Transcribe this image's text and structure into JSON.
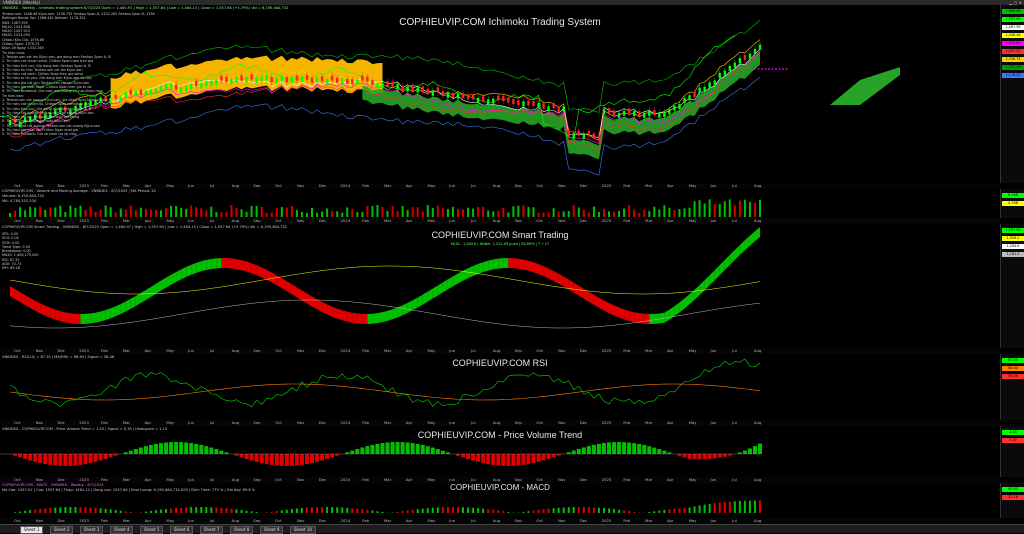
{
  "window": {
    "title": "VNINDEX (Weekly)"
  },
  "panes": {
    "ichimoku": {
      "title": "COPHIEUVIP.COM Ichimoku Trading System",
      "header": "VNINDEX - Weekly - Ichimoku trading system 8/7/2025 Open = 1,460.97 | High = 1,557.64 | Low = 1,464.15 | Close = 1,557.64 (+5.79%) Vol = 6,190,484,732",
      "legend": [
        "Tenkan-sen: 1448.48   Kijun-sen: 1336.735   Senkou Span A: 1332.262   Senkou Span B: 1336",
        "Bollinger Bands Top: 1566.461   Bottom: 1178.331",
        "MA5: 1487.955",
        "MA10: 1423.608",
        "MA20: 1407.523",
        "MA50: 1323.094",
        "Chikou Khu Gia: 1576.86",
        "Chikou Span: 1376.23",
        "Kijun 26 Ngay: 1332.263",
        "Tin hieu mua:",
        "1. Tenkan-sen cat len Kijun-sen, gia dong tren Senkou Span A, B",
        "2. Tin hieu cat chuan xanh, Chikou Span nam tren gia",
        "3. Tin hieu tich cuc: Gia dong tren Senkou Span A, B",
        "4. Tin hieu tin tim: Tenkan-sen cat len Kijun-sen",
        "5. Tin hieu cat xanh: Chikou Span tren gia dong",
        "6. Tin hieu tu tin yeu: Gia dong tren Kijun-sen va day",
        "7. Tin hieu gia cat len: Tenkan-sen cat len Kijun-sen",
        "8. Tin hieu gia vuot xanh: Chikou Span tren gia tu do",
        "9. Tin hieu Breakout: Gia vuot qua khang cu cua nhieu may",
        "Tin hieu ban:",
        "1. Tenkan-sen cat xuong Kijun-sen, gia dong duoi Senkou Span A, B",
        "2. Tin hieu cat chuan do, Chikou Span nam duoi gia",
        "3. Tin hieu tieu cuc: Gia dong duoi Senkou Span A, B",
        "4. Tin hieu cat xuong: Tenkan-sen cat xuong Kijun-sen",
        "5. Tin hieu cat do: Chikou Span duoi gia dong",
        "6. Tin hieu yeu: Gia dong duoi Kijun-sen",
        "7. Tin hieu gia cat xuong: Tenkan-sen cat xuong Kijun-sen",
        "8. Tin hieu gia vuot do: Chikou Span duoi gia",
        "9. Tin hieu Pullback: Gia ve kiem tra lai may"
      ],
      "price_tags": [
        {
          "label": "1,566.46",
          "color": "#00c000"
        },
        {
          "label": "1,557.64",
          "color": "#00ff00"
        },
        {
          "label": "1,487.95",
          "color": "#ffffff"
        },
        {
          "label": "1,448.48",
          "color": "#ffff00"
        },
        {
          "label": "1,423.61",
          "color": "#ff00ff"
        },
        {
          "label": "1,407.52",
          "color": "#ff3030"
        },
        {
          "label": "1,336.74",
          "color": "#ffd000"
        },
        {
          "label": "1,332.26",
          "color": "#00a000"
        },
        {
          "label": "1,178.33",
          "color": "#3a78ff"
        }
      ]
    },
    "volume": {
      "header": "COPHIEUVIP.COM - Volume and Moving Average - VNINDEX - 8/7/2025 | MA Period: 20",
      "line2": "Volume: 6,190,484,732",
      "line3": "MA: 4,784,352,334",
      "tags": [
        {
          "label": "6.19B",
          "color": "#00ff00"
        },
        {
          "label": "4.78B",
          "color": "#ffff00"
        }
      ]
    },
    "smart": {
      "title": "COPHIEUVIP.COM Smart Trading",
      "header": "COPHIEUVIP.COM Smart Trading - VNINDEX - 8/7/2025 Open = 1,460.97 | High = 1,557.64 | Low = 1,464.15 | Close = 1,557.64 (+5.79%) Vol = 6,190,484,732",
      "subtitle": "MUA - 1,284.8 | Nhắm: 1,212.83 point | 26.89% | T + 17",
      "legend": [
        "SPS: 0.00",
        "SCH: 0.00",
        "SCM: 0.00",
        "Trend Type: 0.00",
        "Breakdown: 0.00",
        "MA50: 1,406,175,000",
        "RSI: 87.35",
        "ADX: 70.73",
        "MFI: 89.28"
      ],
      "tags": [
        {
          "label": "1,557.64",
          "color": "#00ff00"
        },
        {
          "label": "1,506.2",
          "color": "#ffff00"
        },
        {
          "label": "1,284.8",
          "color": "#ffffff"
        },
        {
          "label": "1,181.3",
          "color": "#bbbbbb"
        }
      ]
    },
    "rsi": {
      "title": "COPHIEUVIP.COM RSI",
      "header": "VNINDEX - RSI(14) = 87.35 | MA(RSI) = 66.64 | Signal = 58.46",
      "tags": [
        {
          "label": "87.35",
          "color": "#00ff00"
        },
        {
          "label": "66.64",
          "color": "#ff8000"
        },
        {
          "label": "58.46",
          "color": "#ff3030"
        }
      ]
    },
    "pvt": {
      "title": "COPHIEUVIP.COM - Price Volume Trend",
      "header": "VNINDEX - COPHIEUVIP.COM - Price Volume Trend = 1.45 | Signal = 0.30 | Histogram = 1.15",
      "tags": [
        {
          "label": "1.45",
          "color": "#00ff00"
        },
        {
          "label": "0.30",
          "color": "#ff3030"
        }
      ]
    },
    "macd": {
      "title": "COPHIEUVIP.COM - MACD",
      "header": "COPHIEUVIP.COM - MACD - VNINDEX - Weekly - 8/7/2025",
      "line2": "Ma Cao: 1457.01 | Cao: 1557.64 | Thap: 1461.12 | Dong cua: 1557.64 | Khoi Luong: 6,190,484,732.000 | Dinh Time: 775 % | Gia day: 89.6 %",
      "tags": [
        {
          "label": "45.83",
          "color": "#00ff00"
        },
        {
          "label": "32.18",
          "color": "#ff3030"
        }
      ]
    }
  },
  "xaxis_labels": [
    "Oct",
    "Nov",
    "Dec",
    "2023",
    "Feb",
    "Mar",
    "Apr",
    "May",
    "Jun",
    "Jul",
    "Aug",
    "Sep",
    "Oct",
    "Nov",
    "Dec",
    "2024",
    "Feb",
    "Mar",
    "Apr",
    "May",
    "Jun",
    "Jul",
    "Aug",
    "Sep",
    "Oct",
    "Nov",
    "Dec",
    "2025",
    "Feb",
    "Mar",
    "Apr",
    "May",
    "Jun",
    "Jul",
    "Aug"
  ],
  "sheet_tabs": [
    "Sheet 1",
    "Sheet 2",
    "Sheet 3",
    "Sheet 4",
    "Sheet 5",
    "Sheet 6",
    "Sheet 7",
    "Sheet 8",
    "Sheet 9",
    "Sheet 10"
  ],
  "colors": {
    "bull": "#00c000",
    "bear": "#e00000",
    "cloud_bull": "#27a327",
    "cloud_bear": "#f5b400",
    "accent": "#ff00ff"
  }
}
